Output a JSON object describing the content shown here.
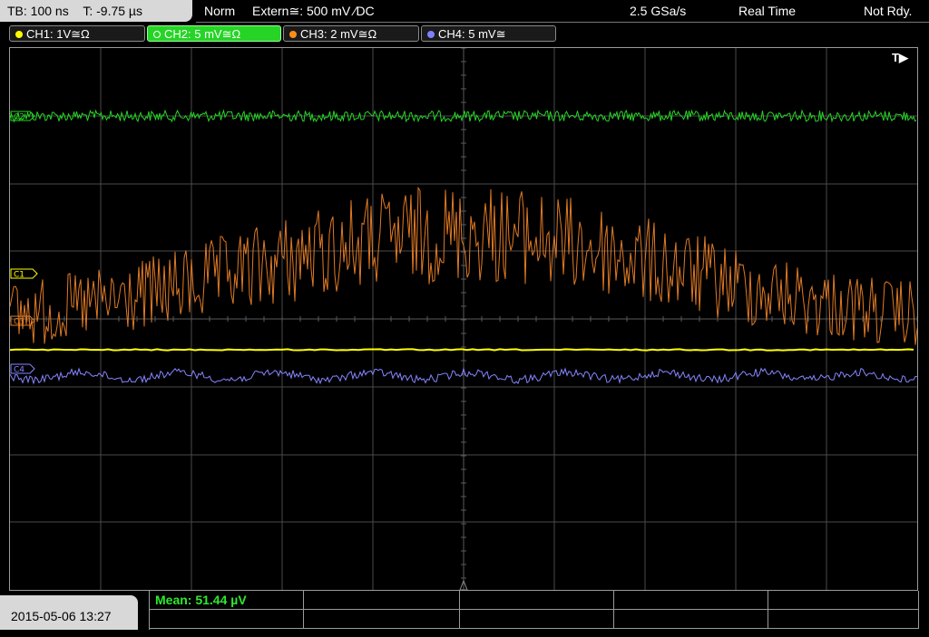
{
  "timebase": {
    "tb": "TB: 100 ns",
    "trigger_time": "T: -9.75 µs"
  },
  "status": {
    "mode": "Norm",
    "trigger": "Extern≅: 500 mV ∕DC",
    "sample_rate": "2.5 GSa/s",
    "acq_mode": "Real Time",
    "state": "Not Rdy."
  },
  "channels": [
    {
      "label": "CH1: 1V≅Ω",
      "color": "#ffff00",
      "active": false
    },
    {
      "label": "CH2: 5 mV≅Ω",
      "color": "#26d426",
      "active": true
    },
    {
      "label": "CH3: 2 mV≅Ω",
      "color": "#ff8c1a",
      "active": false
    },
    {
      "label": "CH4: 5 mV≅",
      "color": "#8080ff",
      "active": false
    }
  ],
  "markers": {
    "c1": "C1",
    "c2": "C2",
    "c3": "C3",
    "c4": "C4",
    "trigger": "T▶"
  },
  "colors": {
    "ch1": "#ffff00",
    "ch2": "#26d426",
    "ch3": "#e07a24",
    "ch4": "#8585ff",
    "grid": "#555555"
  },
  "datetime": "2015-05-06 13:27",
  "measurement": {
    "label": "Mean: 51.44 µV"
  }
}
